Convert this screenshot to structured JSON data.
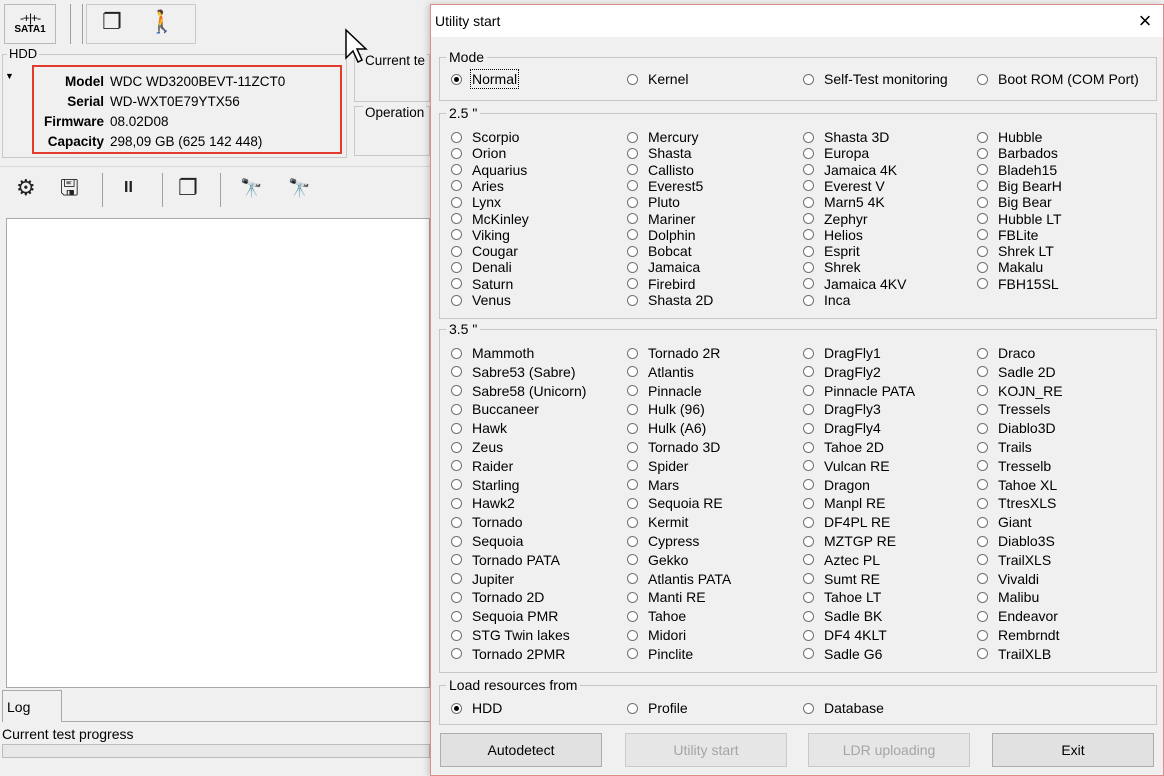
{
  "main": {
    "sata_label": "SATA1",
    "hdd_group": "HDD",
    "hdd_info": [
      {
        "key": "Model",
        "value": "WDC WD3200BEVT-11ZCT0"
      },
      {
        "key": "Serial",
        "value": "WD-WXT0E79YTX56"
      },
      {
        "key": "Firmware",
        "value": "08.02D08"
      },
      {
        "key": "Capacity",
        "value": "298,09 GB (625 142 448)"
      }
    ],
    "current_group": "Current te",
    "operation_group": "Operation",
    "log_tab": "Log",
    "progress_label": "Current test progress"
  },
  "dialog": {
    "title": "Utility start",
    "close": "×",
    "mode_legend": "Mode",
    "mode_options": [
      "Normal",
      "Kernel",
      "Self-Test monitoring",
      "Boot ROM (COM Port)"
    ],
    "mode_selected": "Normal",
    "group25_legend": "2.5 \"",
    "group25": [
      [
        "Scorpio",
        "Orion",
        "Aquarius",
        "Aries",
        "Lynx",
        "McKinley",
        "Viking",
        "Cougar",
        "Denali",
        "Saturn",
        "Venus"
      ],
      [
        "Mercury",
        "Shasta",
        "Callisto",
        "Everest5",
        "Pluto",
        "Mariner",
        "Dolphin",
        "Bobcat",
        "Jamaica",
        "Firebird",
        "Shasta 2D"
      ],
      [
        "Shasta 3D",
        "Europa",
        "Jamaica 4K",
        "Everest V",
        "Marn5 4K",
        "Zephyr",
        "Helios",
        "Esprit",
        "Shrek",
        "Jamaica 4KV",
        "Inca"
      ],
      [
        "Hubble",
        "Barbados",
        "Bladeh15",
        "Big BearH",
        "Big Bear",
        "Hubble LT",
        "FBLite",
        "Shrek LT",
        "Makalu",
        "FBH15SL"
      ]
    ],
    "group35_legend": "3.5 \"",
    "group35": [
      [
        "Mammoth",
        "Sabre53 (Sabre)",
        "Sabre58 (Unicorn)",
        "Buccaneer",
        "Hawk",
        "Zeus",
        "Raider",
        "Starling",
        "Hawk2",
        "Tornado",
        "Sequoia",
        "Tornado PATA",
        "Jupiter",
        "Tornado 2D",
        "Sequoia PMR",
        "STG Twin lakes",
        "Tornado 2PMR"
      ],
      [
        "Tornado 2R",
        "Atlantis",
        "Pinnacle",
        "Hulk (96)",
        "Hulk (A6)",
        "Tornado 3D",
        "Spider",
        "Mars",
        "Sequoia RE",
        "Kermit",
        "Cypress",
        "Gekko",
        "Atlantis PATA",
        "Manti RE",
        "Tahoe",
        "Midori",
        "Pinclite"
      ],
      [
        "DragFly1",
        "DragFly2",
        "Pinnacle PATA",
        "DragFly3",
        "DragFly4",
        "Tahoe 2D",
        "Vulcan RE",
        "Dragon",
        "Manpl RE",
        "DF4PL RE",
        "MZTGP RE",
        "Aztec PL",
        "Sumt RE",
        "Tahoe LT",
        "Sadle BK",
        "DF4 4KLT",
        "Sadle G6"
      ],
      [
        "Draco",
        "Sadle 2D",
        "KOJN_RE",
        "Tressels",
        "Diablo3D",
        "Trails",
        "Tresselb",
        "Tahoe XL",
        "TtresXLS",
        "Giant",
        "Diablo3S",
        "TrailXLS",
        "Vivaldi",
        "Malibu",
        "Endeavor",
        "Rembrndt",
        "TrailXLB"
      ]
    ],
    "load_legend": "Load resources from",
    "load_options": [
      "HDD",
      "Profile",
      "Database"
    ],
    "load_selected": "HDD",
    "buttons": {
      "autodetect": "Autodetect",
      "utility_start": "Utility start",
      "ldr_uploading": "LDR uploading",
      "exit": "Exit"
    }
  }
}
